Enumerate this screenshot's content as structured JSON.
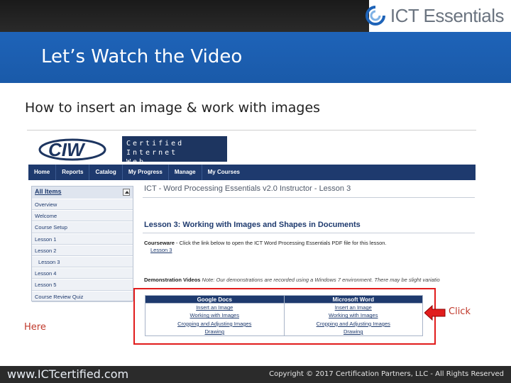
{
  "brand": {
    "logo_text": "ICT Essentials"
  },
  "slide": {
    "title": "Let’s Watch the Video",
    "subtitle": "How to insert an image & work with images"
  },
  "screenshot": {
    "ciw": {
      "logo_text": "CIW",
      "badge_line1": "Certified Internet",
      "badge_line2": "Web Professional"
    },
    "nav": [
      "Home",
      "Reports",
      "Catalog",
      "My Progress",
      "Manage",
      "My Courses"
    ],
    "sidebar": {
      "heading": "All Items",
      "items": [
        {
          "label": "Overview",
          "indent": false
        },
        {
          "label": "Welcome",
          "indent": false
        },
        {
          "label": "Course Setup",
          "indent": false
        },
        {
          "label": "Lesson 1",
          "indent": false
        },
        {
          "label": "Lesson 2",
          "indent": false
        },
        {
          "label": "Lesson 3",
          "indent": true
        },
        {
          "label": "Lesson 4",
          "indent": false
        },
        {
          "label": "Lesson 5",
          "indent": false
        },
        {
          "label": "Course Review Quiz",
          "indent": false
        }
      ]
    },
    "main": {
      "course_title": "ICT - Word Processing Essentials v2.0 Instructor - Lesson 3",
      "lesson_heading": "Lesson 3: Working with Images and Shapes in Documents",
      "courseware_label": "Courseware",
      "courseware_text": " - Click the link below to open the ICT Word Processing Essentials PDF file for this lesson.",
      "courseware_link": "Lesson 3",
      "demo_label": "Demonstration Videos",
      "demo_note": " Note: Our demonstrations are recorded using a Windows 7 environment. There may be slight variatio"
    },
    "videos": {
      "headers": [
        "Google Docs",
        "Microsoft Word"
      ],
      "rows": [
        [
          "Insert an Image",
          "Insert an Image"
        ],
        [
          "Working with Images",
          "Working with Images"
        ],
        [
          "Cropping and Adjusting Images",
          "Cropping and Adjusting Images"
        ],
        [
          "Drawing",
          "Drawing"
        ]
      ]
    }
  },
  "annotations": {
    "click": "Click",
    "here": "Here",
    "color": "#e11c1c"
  },
  "footer": {
    "url": "www.ICTcertified.com",
    "copyright": "Copyright © 2017 Certification Partners, LLC - All Rights Reserved"
  }
}
